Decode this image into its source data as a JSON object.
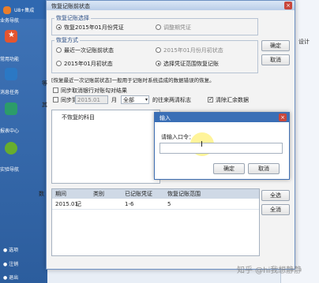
{
  "app": {
    "top_label": "U8+集成",
    "sidebar_items": [
      {
        "label": "业务导航",
        "color": "#e87d2b"
      },
      {
        "label": "常用功能",
        "color": "#e4552f"
      },
      {
        "label": "消息任务",
        "color": "#2b78c4"
      },
      {
        "label": "报表中心",
        "color": "#2c9c6a"
      },
      {
        "label": "实验导航",
        "color": "#67ad2e"
      }
    ],
    "bottom_items": [
      "选项",
      "注销",
      "退出"
    ],
    "right_top_label": "设计"
  },
  "dialog": {
    "title": "恢复记账前状态",
    "close_glyph": "×",
    "group1_title": "恢复记账选择",
    "group1_options": [
      "恢复2015年01月份凭证",
      "调整期凭证"
    ],
    "group2_title": "恢复方式",
    "group2_options": [
      "最近一次记账前状态",
      "2015年01月份月初状态",
      "2015年01月初状态",
      "选择凭证范围恢复记账"
    ],
    "ok_label": "确定",
    "cancel_label": "取消",
    "hint": "[恢复最近一次记账前状态]一般用于记账时系统造成的数据错误的恢复。",
    "sync_label": "同步取消银行对账勾对结果",
    "sync_sub_prefix": "同步到",
    "sync_date": "2015.01",
    "month_suffix": "月",
    "all_option": "全部",
    "tick_label": "的往来两清标志",
    "clear_label": "清除汇余数据",
    "side_letters": [
      "等",
      "其"
    ],
    "list_label": "不恢复的科目",
    "column_labels": [
      "数"
    ],
    "select_all_label": "全选",
    "deselect_label": "全消"
  },
  "table": {
    "headers": [
      "期间",
      "类别",
      "已记账凭证",
      "恢复记账范围"
    ],
    "rows": [
      [
        "2015.01",
        "记",
        "1-6",
        "5"
      ]
    ]
  },
  "popup": {
    "title": "输入",
    "close_glyph": "×",
    "prompt": "请输入口令：",
    "password_value": "",
    "ok_label": "确定",
    "cancel_label": "取消"
  },
  "watermark": "知乎 @hi我想静静"
}
